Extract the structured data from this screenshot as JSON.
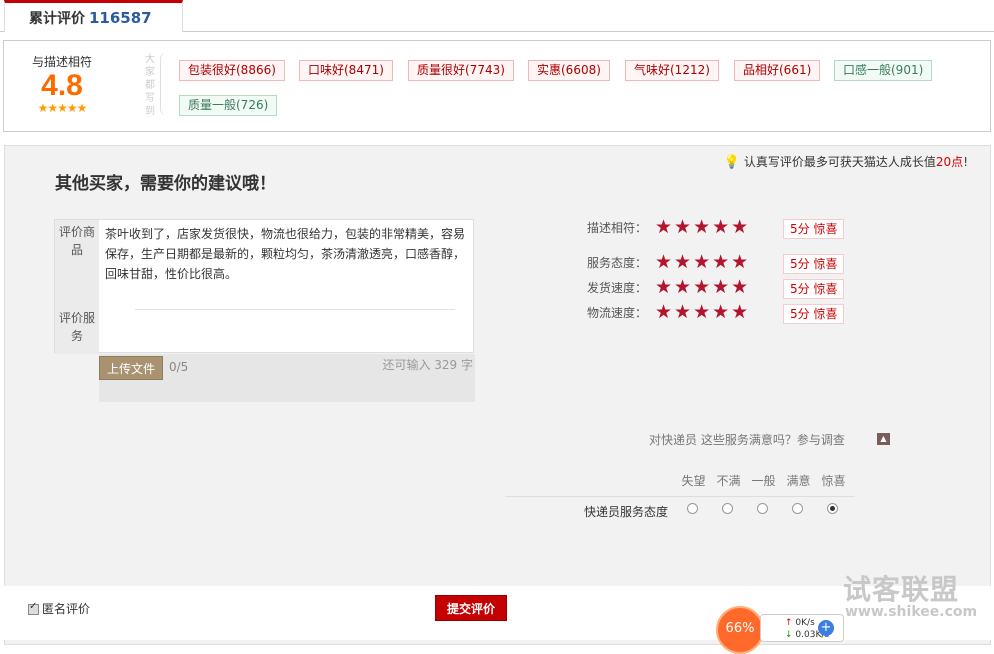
{
  "tab": {
    "label": "累计评价",
    "count": "116587"
  },
  "summary": {
    "score_label": "与描述相符",
    "score": "4.8",
    "stars": "★★★★★",
    "everyone_wrote": "大家都写到",
    "tags": [
      {
        "label": "包装很好(8866)",
        "type": "positive"
      },
      {
        "label": "口味好(8471)",
        "type": "positive"
      },
      {
        "label": "质量很好(7743)",
        "type": "positive"
      },
      {
        "label": "实惠(6608)",
        "type": "positive"
      },
      {
        "label": "气味好(1212)",
        "type": "positive"
      },
      {
        "label": "品相好(661)",
        "type": "positive"
      },
      {
        "label": "口感一般(901)",
        "type": "neutral"
      },
      {
        "label": "质量一般(726)",
        "type": "neutral"
      }
    ]
  },
  "form": {
    "title": "其他买家，需要你的建议哦！",
    "tip_prefix": "认真写评价最多可获天猫达人成长值",
    "tip_highlight": "20点",
    "tip_suffix": "!",
    "product_label": "评价商品",
    "service_label": "评价服务",
    "review_text": "茶叶收到了，店家发货很快，物流也很给力，包装的非常精美，容易保存，生产日期都是最新的，颗粒均匀，茶汤清澈透亮，口感香醇，回味甘甜，性价比很高。",
    "upload_label": "上传文件",
    "upload_count": "0/5",
    "remaining": "还可输入 329 字"
  },
  "ratings": [
    {
      "label": "描述相符：",
      "stars": "★★★★★",
      "result": "5分  惊喜"
    },
    {
      "label": "服务态度：",
      "stars": "★★★★★",
      "result": "5分  惊喜"
    },
    {
      "label": "发货速度：",
      "stars": "★★★★★",
      "result": "5分  惊喜"
    },
    {
      "label": "物流速度：",
      "stars": "★★★★★",
      "result": "5分  惊喜"
    }
  ],
  "express": {
    "question": "对快递员  这些服务满意吗？参与调查",
    "options": [
      "失望",
      "不满",
      "一般",
      "满意",
      "惊喜"
    ],
    "row_label": "快递员服务态度",
    "selected_index": 4
  },
  "footer": {
    "anonymous_label": "匿名评价",
    "anonymous_checked": true,
    "submit_label": "提交评价"
  },
  "overlay": {
    "watermark": "试客联盟",
    "watermark_url": "www.shikee.com",
    "net_percent": "66%",
    "net_up": "0K/s",
    "net_down": "0.03K/s"
  },
  "colors": {
    "accent": "#c40000",
    "score": "#ff6a00",
    "star": "#b2162e"
  }
}
